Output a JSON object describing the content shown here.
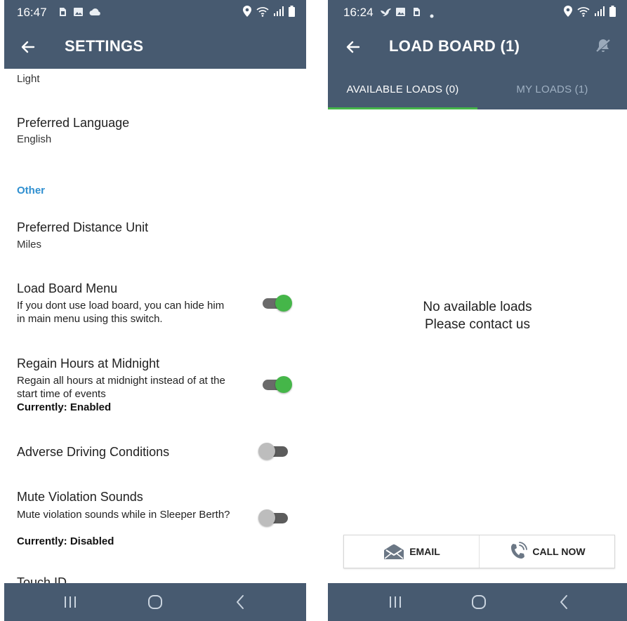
{
  "left": {
    "status_bar": {
      "time": "16:47",
      "notif_icons": [
        "sim-card-icon",
        "image-icon",
        "cloud-icon"
      ]
    },
    "app_bar": {
      "title": "SETTINGS"
    },
    "settings": {
      "theme_value": "Light",
      "language": {
        "label": "Preferred Language",
        "value": "English"
      },
      "section_other": "Other",
      "distance": {
        "label": "Preferred Distance Unit",
        "value": "Miles"
      },
      "load_board_menu": {
        "label": "Load Board Menu",
        "description": "If you dont use load board, you can hide him in main menu using this switch.",
        "enabled": true
      },
      "regain_hours": {
        "label": "Regain Hours at Midnight",
        "description": "Regain all hours at midnight instead of at the start time of events",
        "status": "Currently: Enabled",
        "enabled": true
      },
      "adverse_driving": {
        "label": "Adverse Driving Conditions",
        "enabled": false
      },
      "mute_violation": {
        "label": "Mute Violation Sounds",
        "description": "Mute violation sounds while in Sleeper Berth?",
        "status": "Currently: Disabled",
        "enabled": false
      },
      "touch_id": {
        "label": "Touch ID"
      }
    }
  },
  "right": {
    "status_bar": {
      "time": "16:24",
      "notif_icons": [
        "bird-icon",
        "image-icon",
        "sim-card-icon",
        "dot-icon"
      ]
    },
    "app_bar": {
      "title": "LOAD BOARD (1)"
    },
    "tabs": [
      {
        "label": "AVAILABLE LOADS (0)",
        "active": true
      },
      {
        "label": "MY LOADS (1)",
        "active": false
      }
    ],
    "empty_state": {
      "line1": "No available loads",
      "line2": "Please contact us"
    },
    "actions": {
      "email_label": "EMAIL",
      "call_label": "CALL NOW"
    }
  },
  "colors": {
    "app_bar": "#475a70",
    "accent_green": "#45b649",
    "section_blue": "#2f8fd0",
    "tab_inactive": "#9fb0c2"
  }
}
